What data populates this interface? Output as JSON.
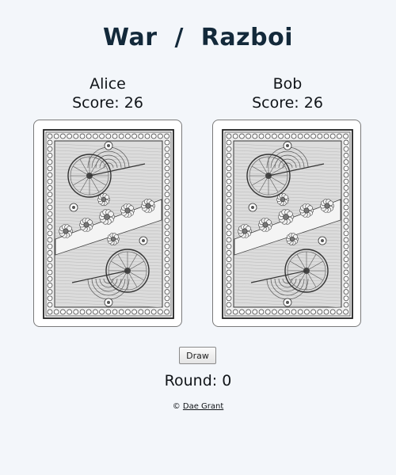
{
  "title": "War  /  Razboi",
  "players": [
    {
      "name": "Alice",
      "score_label": "Score:",
      "score": "26"
    },
    {
      "name": "Bob",
      "score_label": "Score:",
      "score": "26"
    }
  ],
  "cards": [
    {
      "face": "back",
      "icon": "card-back-ornate"
    },
    {
      "face": "back",
      "icon": "card-back-ornate"
    }
  ],
  "draw_button": {
    "label": "Draw"
  },
  "round": {
    "label": "Round:",
    "value": "0"
  },
  "credit": {
    "symbol": "©",
    "author": "Dae Grant"
  }
}
